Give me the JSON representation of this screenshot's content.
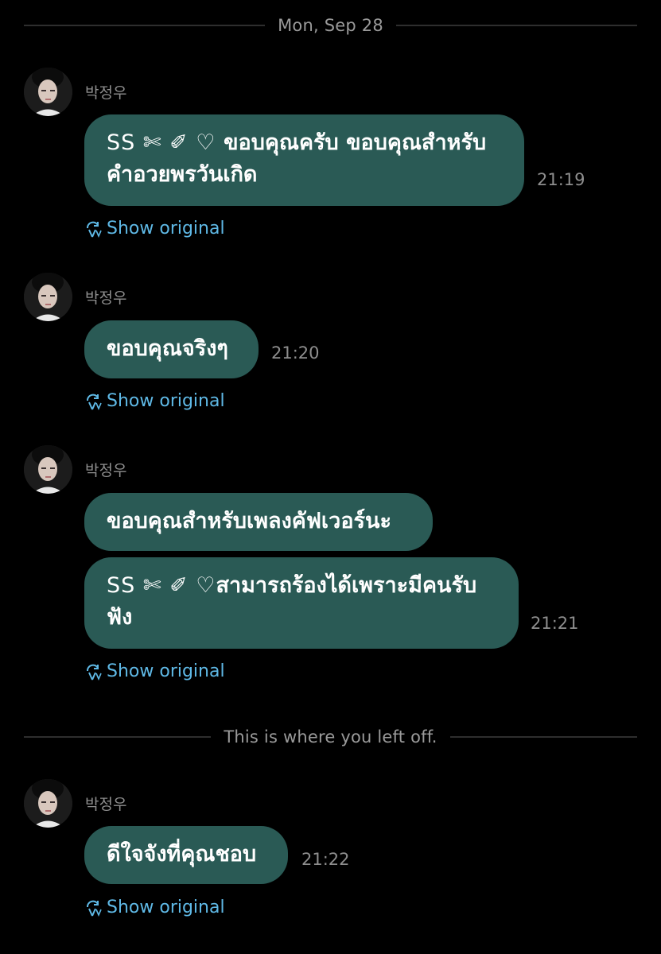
{
  "date_divider": "Mon, Sep 28",
  "left_off_divider": "This is where you left off.",
  "colors": {
    "background": "#000000",
    "bubble": "#2a5a55",
    "link": "#5fb9e6",
    "muted": "#8e8e8e"
  },
  "show_original_label": "Show original",
  "show_original_icon": "translate-icon",
  "groups": [
    {
      "sender": "박정우",
      "messages": [
        {
          "prefix": "SS ✄ ✐ ♡ ",
          "text": "ขอบคุณครับ ขอบคุณสำหรับคำอวยพรวันเกิด"
        }
      ],
      "time": "21:19"
    },
    {
      "sender": "박정우",
      "messages": [
        {
          "prefix": "",
          "text": "ขอบคุณจริงๆ"
        }
      ],
      "time": "21:20"
    },
    {
      "sender": "박정우",
      "messages": [
        {
          "prefix": "",
          "text": "ขอบคุณสำหรับเพลงคัฟเวอร์นะ"
        },
        {
          "prefix": "SS ✄ ✐ ♡",
          "text": "สามารถร้องได้เพราะมีคนรับฟัง"
        }
      ],
      "time": "21:21"
    },
    {
      "sender": "박정우",
      "messages": [
        {
          "prefix": "",
          "text": "ดีใจจังที่คุณชอบ"
        }
      ],
      "time": "21:22"
    }
  ]
}
